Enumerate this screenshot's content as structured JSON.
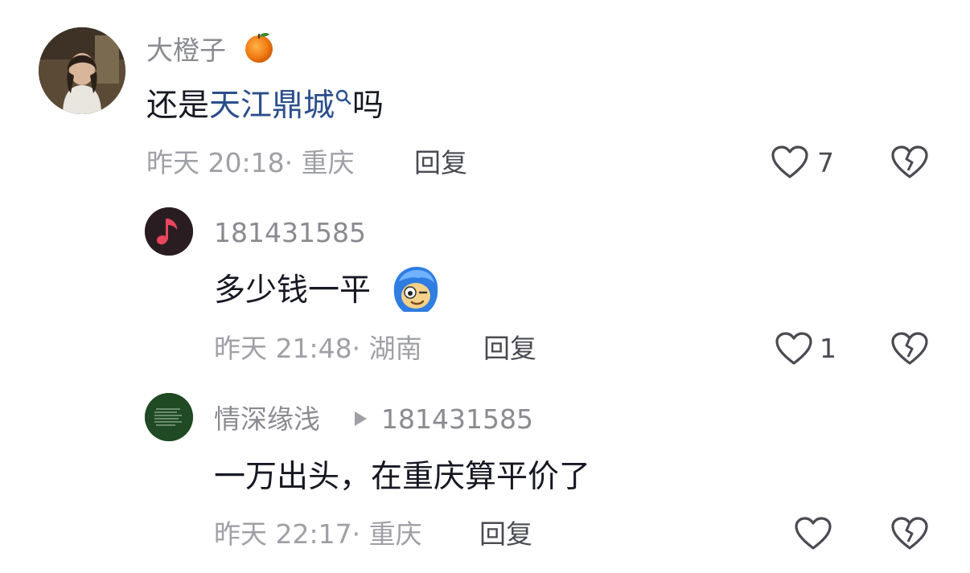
{
  "comments": [
    {
      "username": "大橙子",
      "username_emoji": "orange-emoji",
      "text_prefix": "还是",
      "text_link": "天江鼎城",
      "text_suffix": "吗",
      "meta": "昨天 20:18· 重庆",
      "reply_label": "回复",
      "like_count": "7"
    },
    {
      "username": "181431585",
      "text": "多少钱一平",
      "text_emoji": "blue-hair-face-emoji",
      "meta": "昨天 21:48· 湖南",
      "reply_label": "回复",
      "like_count": "1"
    },
    {
      "username": "情深缘浅",
      "reply_to": "181431585",
      "text": "一万出头，在重庆算平价了",
      "meta": "昨天 22:17· 重庆",
      "reply_label": "回复",
      "like_count": ""
    }
  ],
  "colors": {
    "text": "#161823",
    "secondary": "#8a8b91",
    "link": "#2a4e8c"
  }
}
